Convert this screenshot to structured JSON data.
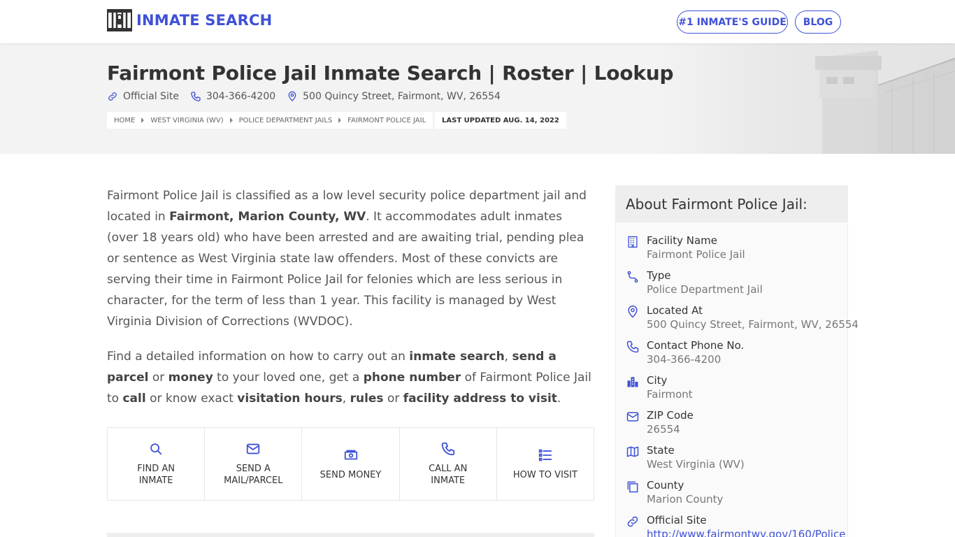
{
  "header": {
    "brand": "INMATE SEARCH",
    "nav": {
      "guide": "#1 INMATE'S GUIDE",
      "blog": "BLOG"
    }
  },
  "hero": {
    "title": "Fairmont Police Jail Inmate Search | Roster | Lookup",
    "official_site": "Official Site",
    "phone": "304-366-4200",
    "address": "500 Quincy Street, Fairmont, WV, 26554",
    "breadcrumbs": [
      "HOME",
      "WEST VIRGINIA (WV)",
      "POLICE DEPARTMENT JAILS",
      "FAIRMONT POLICE JAIL"
    ],
    "last_updated": "LAST UPDATED AUG. 14, 2022"
  },
  "intro": {
    "p1": {
      "a": "Fairmont Police Jail is classified as a low level security police department jail and located in ",
      "b": "Fairmont, Marion County, WV",
      "c": ". It accommodates adult inmates (over 18 years old) who have been arrested and are awaiting trial, pending plea or sentence as West Virginia state law offenders. Most of these convicts are serving their time in Fairmont Police Jail for felonies which are less serious in character, for the term of less than 1 year. This facility is managed by West Virginia Division of Corrections (WVDOC)."
    },
    "p2": {
      "t1": "Find a detailed information on how to carry out an ",
      "b1": "inmate search",
      "t2": ", ",
      "b2": "send a parcel",
      "t3": " or ",
      "b3": "money",
      "t4": " to your loved one, get a ",
      "b4": "phone number",
      "t5": " of Fairmont Police Jail to ",
      "b5": "call",
      "t6": " or know exact ",
      "b6": "visitation hours",
      "t7": ", ",
      "b7": "rules",
      "t8": " or ",
      "b8": "facility address to visit",
      "t9": "."
    }
  },
  "actions": [
    {
      "line1": "FIND AN",
      "line2": "INMATE",
      "icon": "search-icon"
    },
    {
      "line1": "SEND A",
      "line2": "MAIL/PARCEL",
      "icon": "mail-icon"
    },
    {
      "line1": "SEND MONEY",
      "line2": "",
      "icon": "money-icon"
    },
    {
      "line1": "CALL AN",
      "line2": "INMATE",
      "icon": "phone-icon"
    },
    {
      "line1": "HOW TO VISIT",
      "line2": "",
      "icon": "list-icon"
    }
  ],
  "about": {
    "title": "About Fairmont Police Jail:",
    "items": [
      {
        "label": "Facility Name",
        "value": "Fairmont Police Jail",
        "icon": "building-icon"
      },
      {
        "label": "Type",
        "value": "Police Department Jail",
        "icon": "route-icon"
      },
      {
        "label": "Located At",
        "value": "500 Quincy Street, Fairmont, WV, 26554",
        "icon": "map-pin-icon"
      },
      {
        "label": "Contact Phone No.",
        "value": "304-366-4200",
        "icon": "phone-icon"
      },
      {
        "label": "City",
        "value": "Fairmont",
        "icon": "city-icon"
      },
      {
        "label": "ZIP Code",
        "value": "26554",
        "icon": "envelope-icon"
      },
      {
        "label": "State",
        "value": "West Virginia (WV)",
        "icon": "map-icon"
      },
      {
        "label": "County",
        "value": "Marion County",
        "icon": "copy-icon"
      },
      {
        "label": "Official Site",
        "value": "http://www.fairmontwv.gov/160/Police",
        "icon": "link-icon"
      }
    ]
  },
  "colors": {
    "accent": "#3f51d6",
    "hero_bg": "#f3f3f3",
    "text": "#555555"
  }
}
